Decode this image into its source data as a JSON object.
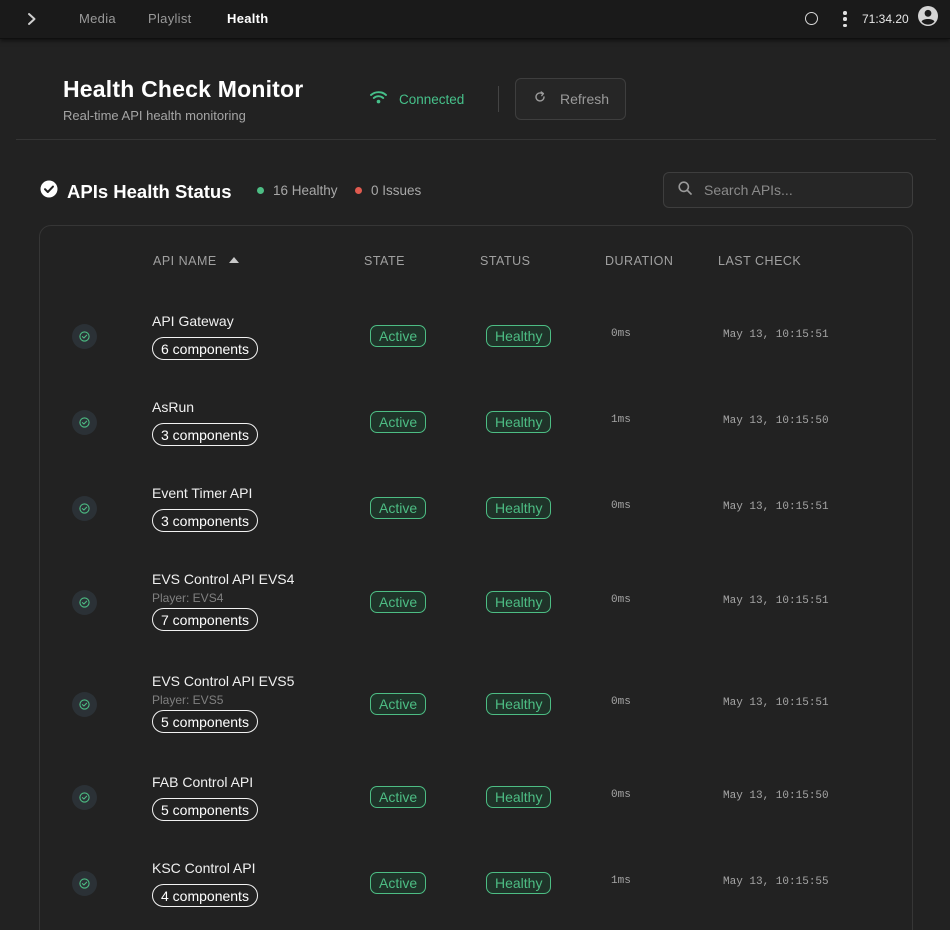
{
  "nav": {
    "tabs": [
      {
        "label": "Media"
      },
      {
        "label": "Playlist"
      },
      {
        "label": "Health"
      }
    ],
    "active_tab": "Health",
    "clock": "71:34.20"
  },
  "header": {
    "title": "Health Check Monitor",
    "subtitle": "Real-time API health monitoring",
    "connection": "Connected",
    "refresh_label": "Refresh"
  },
  "section": {
    "title": "APIs Health Status",
    "healthy_label": "16 Healthy",
    "issues_label": "0 Issues",
    "search_placeholder": "Search APIs..."
  },
  "table": {
    "columns": [
      "API NAME",
      "STATE",
      "STATUS",
      "DURATION",
      "LAST CHECK"
    ],
    "rows": [
      {
        "name": "API Gateway",
        "player": "",
        "components": "6 components",
        "state": "Active",
        "status": "Healthy",
        "duration": "0ms",
        "last_check": "May 13, 10:15:51"
      },
      {
        "name": "AsRun",
        "player": "",
        "components": "3 components",
        "state": "Active",
        "status": "Healthy",
        "duration": "1ms",
        "last_check": "May 13, 10:15:50"
      },
      {
        "name": "Event Timer API",
        "player": "",
        "components": "3 components",
        "state": "Active",
        "status": "Healthy",
        "duration": "0ms",
        "last_check": "May 13, 10:15:51"
      },
      {
        "name": "EVS Control API EVS4",
        "player": "Player: EVS4",
        "components": "7 components",
        "state": "Active",
        "status": "Healthy",
        "duration": "0ms",
        "last_check": "May 13, 10:15:51"
      },
      {
        "name": "EVS Control API EVS5",
        "player": "Player: EVS5",
        "components": "5 components",
        "state": "Active",
        "status": "Healthy",
        "duration": "0ms",
        "last_check": "May 13, 10:15:51"
      },
      {
        "name": "FAB Control API",
        "player": "",
        "components": "5 components",
        "state": "Active",
        "status": "Healthy",
        "duration": "0ms",
        "last_check": "May 13, 10:15:50"
      },
      {
        "name": "KSC Control API",
        "player": "",
        "components": "4 components",
        "state": "Active",
        "status": "Healthy",
        "duration": "1ms",
        "last_check": "May 13, 10:15:55"
      }
    ]
  },
  "colors": {
    "healthy": "#4dbd84",
    "issue": "#e05a4f",
    "background": "#222222"
  },
  "icons": [
    "chevron-right-icon",
    "circle-icon",
    "kebab-menu-icon",
    "account-circle-icon",
    "wifi-icon",
    "refresh-icon",
    "check-circle-icon",
    "search-icon",
    "row-check-icon"
  ]
}
